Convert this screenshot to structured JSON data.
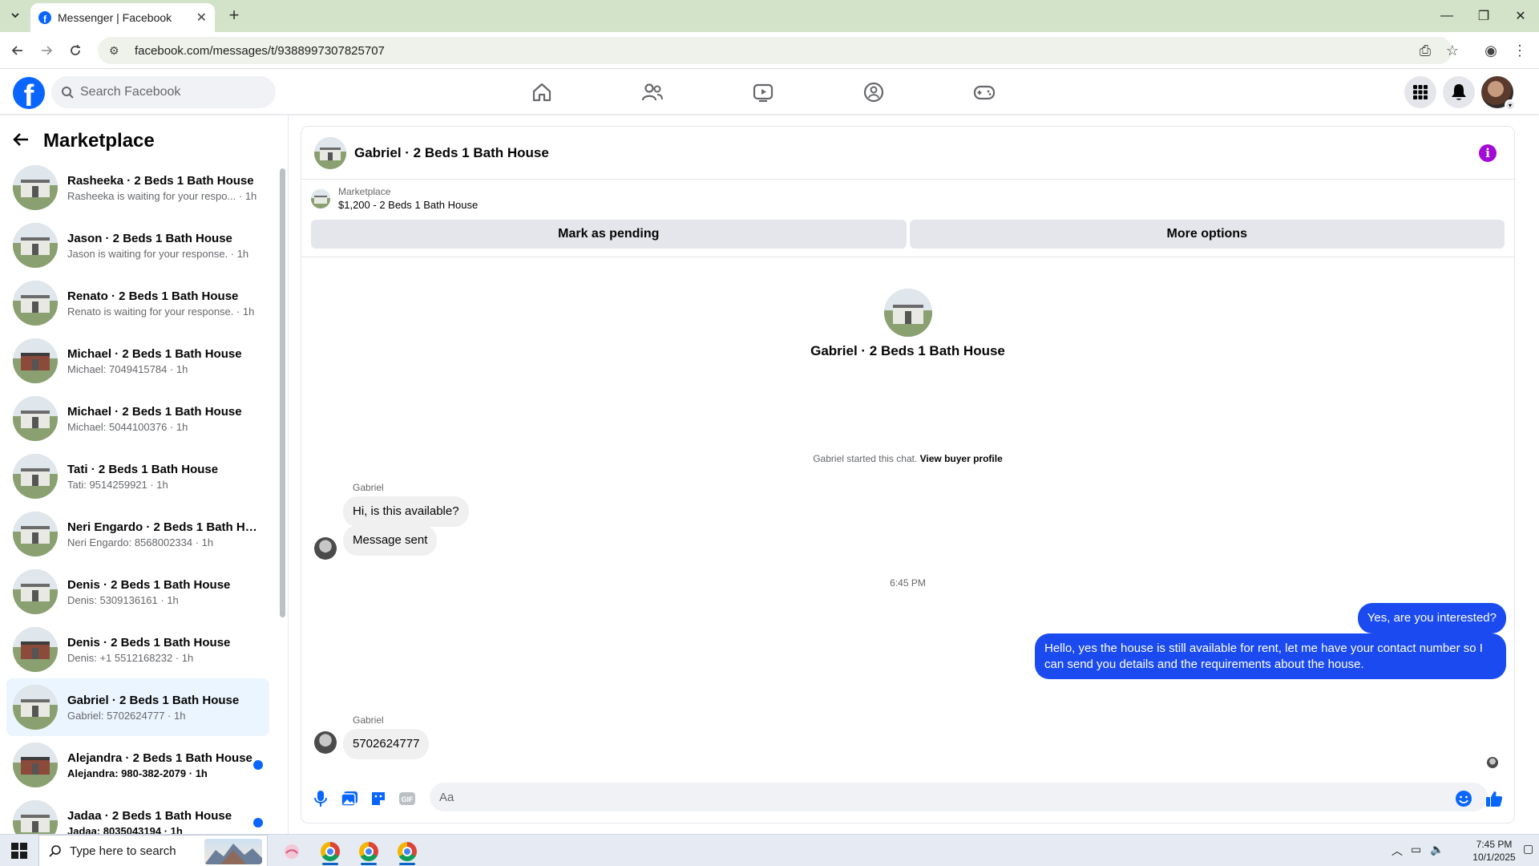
{
  "browser": {
    "tab_title": "Messenger | Facebook",
    "url": "facebook.com/messages/t/9388997307825707"
  },
  "header": {
    "search_placeholder": "Search Facebook"
  },
  "sidebar": {
    "title": "Marketplace",
    "conversations": [
      {
        "name": "Rasheeka · 2 Beds 1 Bath House",
        "sub": "Rasheeka is waiting for your respo... · 1h",
        "unread": false,
        "active": false,
        "thumb": "white"
      },
      {
        "name": "Jason · 2 Beds 1 Bath House",
        "sub": "Jason is waiting for your response. · 1h",
        "unread": false,
        "active": false,
        "thumb": "white"
      },
      {
        "name": "Renato · 2 Beds 1 Bath House",
        "sub": "Renato is waiting for your response. · 1h",
        "unread": false,
        "active": false,
        "thumb": "white"
      },
      {
        "name": "Michael · 2 Beds 1 Bath House",
        "sub": "Michael: 7049415784 · 1h",
        "unread": false,
        "active": false,
        "thumb": "brick"
      },
      {
        "name": "Michael · 2 Beds 1 Bath House",
        "sub": "Michael: 5044100376 · 1h",
        "unread": false,
        "active": false,
        "thumb": "white"
      },
      {
        "name": "Tati · 2 Beds 1 Bath House",
        "sub": "Tati: 9514259921 · 1h",
        "unread": false,
        "active": false,
        "thumb": "white"
      },
      {
        "name": "Neri Engardo · 2 Beds 1 Bath Ho...",
        "sub": "Neri Engardo: 8568002334 · 1h",
        "unread": false,
        "active": false,
        "thumb": "white"
      },
      {
        "name": "Denis · 2 Beds 1 Bath House",
        "sub": "Denis: 5309136161 · 1h",
        "unread": false,
        "active": false,
        "thumb": "white"
      },
      {
        "name": "Denis · 2 Beds 1 Bath House",
        "sub": "Denis: +1 5512168232 · 1h",
        "unread": false,
        "active": false,
        "thumb": "brick"
      },
      {
        "name": "Gabriel · 2 Beds 1 Bath House",
        "sub": "Gabriel: 5702624777 · 1h",
        "unread": false,
        "active": true,
        "thumb": "white"
      },
      {
        "name": "Alejandra · 2 Beds 1 Bath House",
        "sub": "Alejandra: 980-382-2079 · 1h",
        "unread": true,
        "active": false,
        "thumb": "brick"
      },
      {
        "name": "Jadaa · 2 Beds 1 Bath House",
        "sub": "Jadaa: 8035043194 · 1h",
        "unread": true,
        "active": false,
        "thumb": "white"
      }
    ]
  },
  "chat": {
    "title": "Gabriel · 2 Beds 1 Bath House",
    "marketplace_label": "Marketplace",
    "listing": "$1,200 - 2 Beds 1 Bath House",
    "mark_pending": "Mark as pending",
    "more_options": "More options",
    "profile_title": "Gabriel · 2 Beds 1 Bath House",
    "started_text": "Gabriel started this chat.",
    "view_buyer": "View buyer profile",
    "sender_name": "Gabriel",
    "msg1": "Hi, is this available?",
    "msg2": "Message sent",
    "time": "6:45 PM",
    "out1": "Yes, are you interested?",
    "out2": "Hello, yes the house is still available for rent, let me have your contact number so I can send you details and the requirements about the house.",
    "sender_name2": "Gabriel",
    "msg3": "5702624777",
    "composer_placeholder": "Aa"
  },
  "taskbar": {
    "search_text": "Type here to search",
    "time": "7:45 PM",
    "date": "10/1/2025"
  },
  "colors": {
    "fb_blue": "#0866ff",
    "bubble_out": "#1b4bf0",
    "info_purple": "#a30ad6"
  }
}
